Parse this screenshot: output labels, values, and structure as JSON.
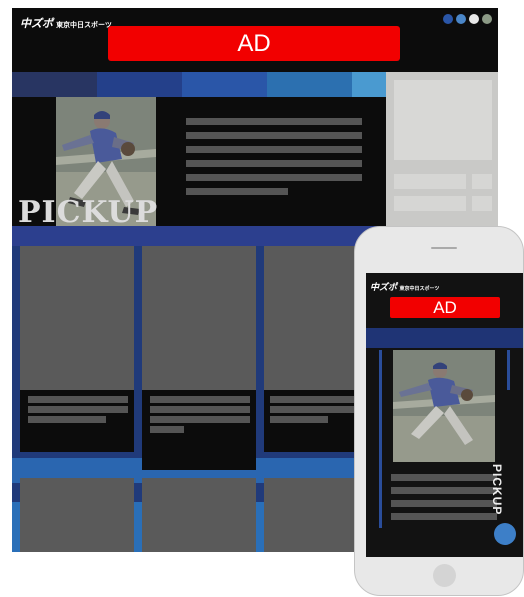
{
  "desktop": {
    "logo": {
      "main": "中ズポ",
      "sub": "東京中日スポーツ"
    },
    "header_dot_colors": [
      "#2a56a8",
      "#4a86c8",
      "#e8e8e8",
      "#8c9a86"
    ],
    "ad_label": "AD",
    "nav_colors": [
      "#283562",
      "#24408a",
      "#2a56a8",
      "#2c70b0",
      "#4a9ad0"
    ],
    "pickup_label": "PICKUP",
    "cards_count_visible": 6
  },
  "mobile": {
    "logo": {
      "main": "中ズポ",
      "sub": "東京中日スポーツ"
    },
    "ad_label": "AD",
    "pickup_label": "PICKUP",
    "accent_color": "#3d7fc8"
  },
  "colors": {
    "ad_red": "#f20000",
    "dark_bg": "#0c0c0c",
    "pickup_blue": "#203a7a",
    "placeholder_gray": "#5a5a5a"
  }
}
